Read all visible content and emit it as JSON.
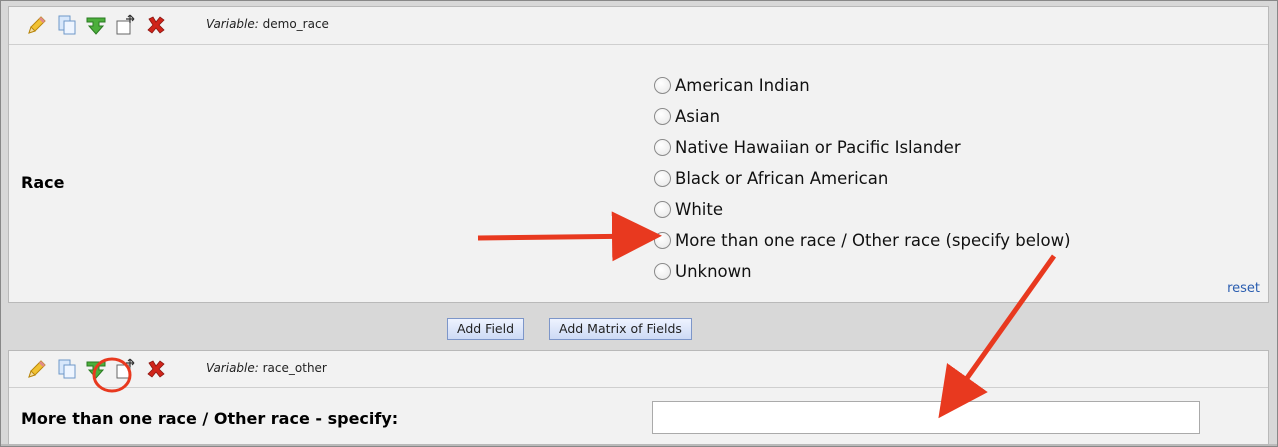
{
  "field1": {
    "variable_prefix": "Variable:",
    "variable_name": "demo_race",
    "question_label": "Race",
    "choices": [
      "American Indian",
      "Asian",
      "Native Hawaiian or Pacific Islander",
      "Black or African American",
      "White",
      "More than one race / Other race (specify below)",
      "Unknown"
    ],
    "reset_label": "reset"
  },
  "buttons": {
    "add_field": "Add Field",
    "add_matrix": "Add Matrix of Fields"
  },
  "field2": {
    "variable_prefix": "Variable:",
    "variable_name": "race_other",
    "question_label": "More than one race / Other race - specify:",
    "input_value": ""
  },
  "icons": [
    "edit-pencil-icon",
    "copy-icon",
    "branching-logic-icon",
    "move-icon",
    "delete-icon"
  ],
  "colors": {
    "annotation_arrow": "#e8391f",
    "link": "#2a5db0",
    "branch_icon": "#3c9a2f",
    "delete_icon": "#d0241a"
  }
}
